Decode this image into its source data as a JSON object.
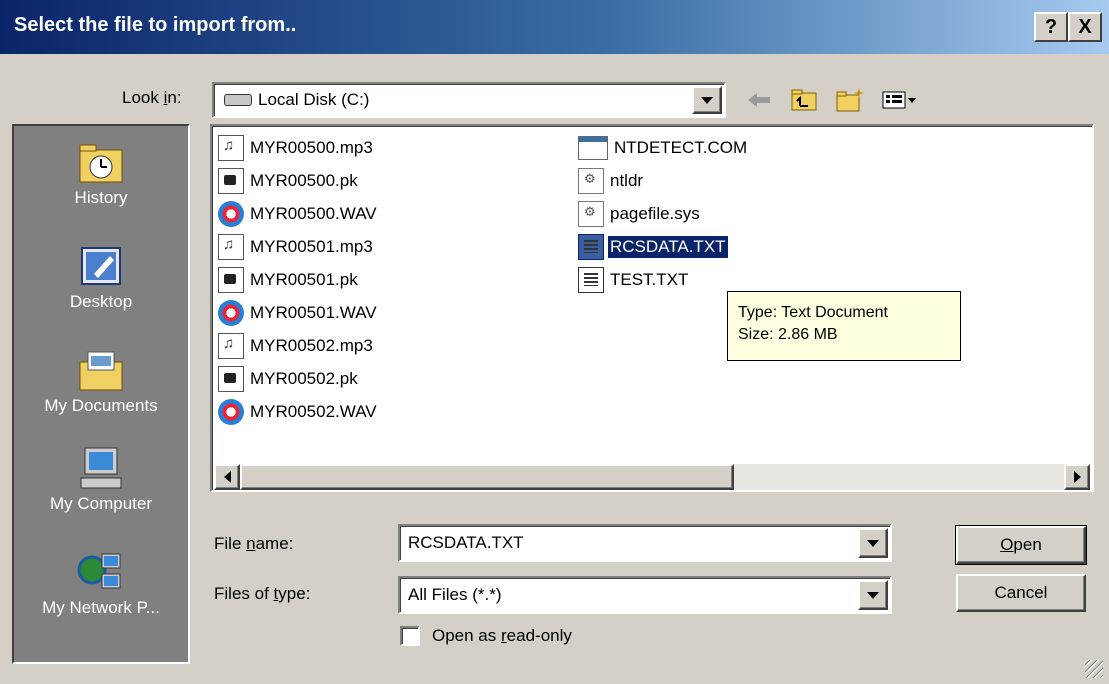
{
  "window": {
    "title": "Select the file to import from..",
    "help_label": "?",
    "close_label": "X"
  },
  "look_in": {
    "label": "Look in:",
    "value": "Local Disk (C:)"
  },
  "toolbar": {
    "icons": [
      "back-icon",
      "up-folder-icon",
      "new-folder-icon",
      "view-menu-icon"
    ]
  },
  "places": [
    {
      "label": "History",
      "icon": "history-icon"
    },
    {
      "label": "Desktop",
      "icon": "desktop-icon"
    },
    {
      "label": "My Documents",
      "icon": "my-documents-icon"
    },
    {
      "label": "My Computer",
      "icon": "my-computer-icon"
    },
    {
      "label": "My Network P...",
      "icon": "my-network-places-icon"
    }
  ],
  "files": {
    "column1": [
      {
        "name": "MYR00500.mp3",
        "type": "mp3"
      },
      {
        "name": "MYR00500.pk",
        "type": "pk"
      },
      {
        "name": "MYR00500.WAV",
        "type": "wav"
      },
      {
        "name": "MYR00501.mp3",
        "type": "mp3"
      },
      {
        "name": "MYR00501.pk",
        "type": "pk"
      },
      {
        "name": "MYR00501.WAV",
        "type": "wav"
      },
      {
        "name": "MYR00502.mp3",
        "type": "mp3"
      },
      {
        "name": "MYR00502.pk",
        "type": "pk"
      },
      {
        "name": "MYR00502.WAV",
        "type": "wav"
      }
    ],
    "column2": [
      {
        "name": "NTDETECT.COM",
        "type": "com"
      },
      {
        "name": "ntldr",
        "type": "sys"
      },
      {
        "name": "pagefile.sys",
        "type": "sys"
      },
      {
        "name": "RCSDATA.TXT",
        "type": "txt",
        "selected": true
      },
      {
        "name": "TEST.TXT",
        "type": "txt"
      }
    ]
  },
  "tooltip": {
    "line1": "Type: Text Document",
    "line2": "Size: 2.86 MB"
  },
  "file_name": {
    "label": "File name:",
    "value": "RCSDATA.TXT"
  },
  "file_type": {
    "label": "Files of type:",
    "value": "All Files (*.*)"
  },
  "read_only": {
    "label": "Open as read-only",
    "checked": false
  },
  "buttons": {
    "open": "Open",
    "cancel": "Cancel"
  }
}
